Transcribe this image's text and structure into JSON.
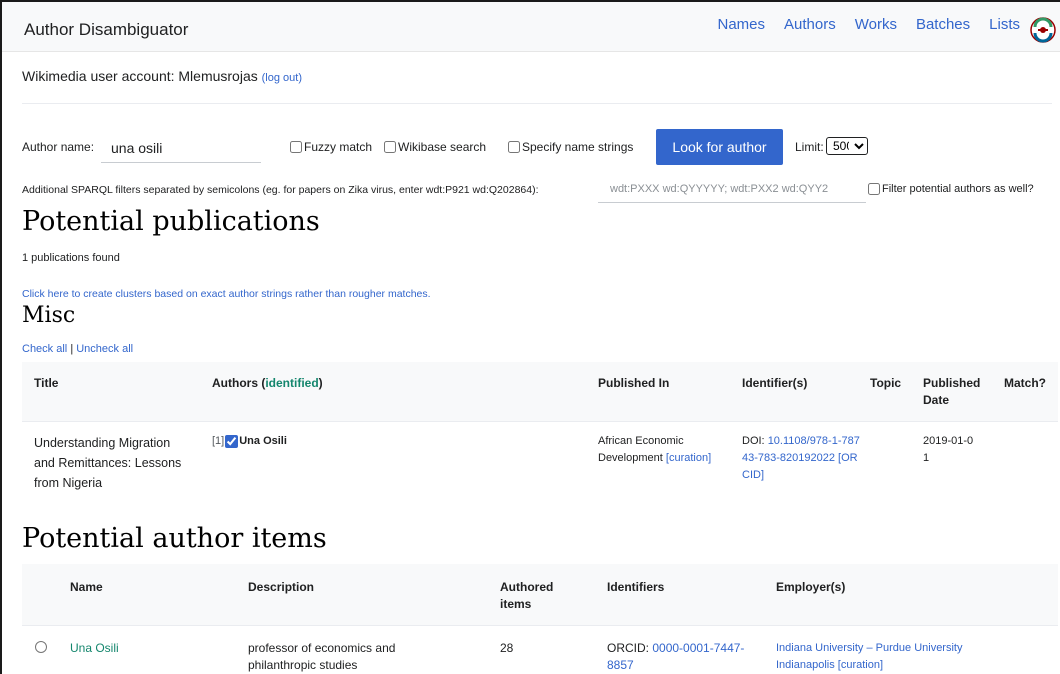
{
  "header": {
    "app_title": "Author Disambiguator",
    "nav": [
      "Names",
      "Authors",
      "Works",
      "Batches",
      "Lists"
    ]
  },
  "account": {
    "text": "Wikimedia user account: Mlemusrojas",
    "logout": "(log out)"
  },
  "search": {
    "author_label": "Author name:",
    "author_value": "una osili",
    "fuzzy_label": "Fuzzy match",
    "wikibase_label": "Wikibase search",
    "name_strings_label": "Specify name strings",
    "button_label": "Look for author",
    "limit_label": "Limit:",
    "limit_value": "500",
    "sparql_label": "Additional SPARQL filters separated by semicolons (eg. for papers on Zika virus, enter wdt:P921 wd:Q202864):",
    "sparql_placeholder": "wdt:PXXX wd:QYYYYY; wdt:PXX2 wd:QYY2",
    "filter_label": "Filter potential authors as well?"
  },
  "publications": {
    "heading": "Potential publications",
    "found_text": "1 publications found",
    "clusters_link": "Click here to create clusters based on exact author strings rather than rougher matches.",
    "group_heading": "Misc",
    "check_all": "Check all",
    "separator": "|",
    "uncheck_all": "Uncheck all",
    "columns": {
      "title": "Title",
      "authors": "Authors (",
      "authors_identified": "identified",
      "authors_close": ")",
      "published_in": "Published In",
      "identifiers": "Identifier(s)",
      "topic": "Topic",
      "published_date": "Published Date",
      "match": "Match?"
    },
    "rows": [
      {
        "title": "Understanding Migration and Remittances: Lessons from Nigeria",
        "author_index": "[1]",
        "author_checked": true,
        "author_name": "Una Osili",
        "published_in": "African Economic Development",
        "published_in_link": "[curation]",
        "doi_label": "DOI:",
        "doi": "10.1108/978-1-78743-783-820192022",
        "orcid_link": "[ORCID]",
        "topic": "",
        "date": "2019-01-01"
      }
    ]
  },
  "authors": {
    "heading": "Potential author items",
    "columns": {
      "name": "Name",
      "description": "Description",
      "authored_items": "Authored items",
      "identifiers": "Identifiers",
      "employers": "Employer(s)"
    },
    "rows": [
      {
        "name": "Una Osili",
        "description": "professor of economics and philanthropic studies",
        "authored_items": "28",
        "orcid_label": "ORCID:",
        "orcid": "0000-0001-7447-8857",
        "employer": "Indiana University – Purdue University Indianapolis",
        "employer_link": "[curation]"
      }
    ]
  },
  "colors": {
    "link": "#3366cc",
    "button": "#3366cc",
    "identified_green": "#14866d",
    "header_bg": "#f8f9fa"
  },
  "icons": {
    "logo": "wikidata-tool-logo-icon"
  }
}
